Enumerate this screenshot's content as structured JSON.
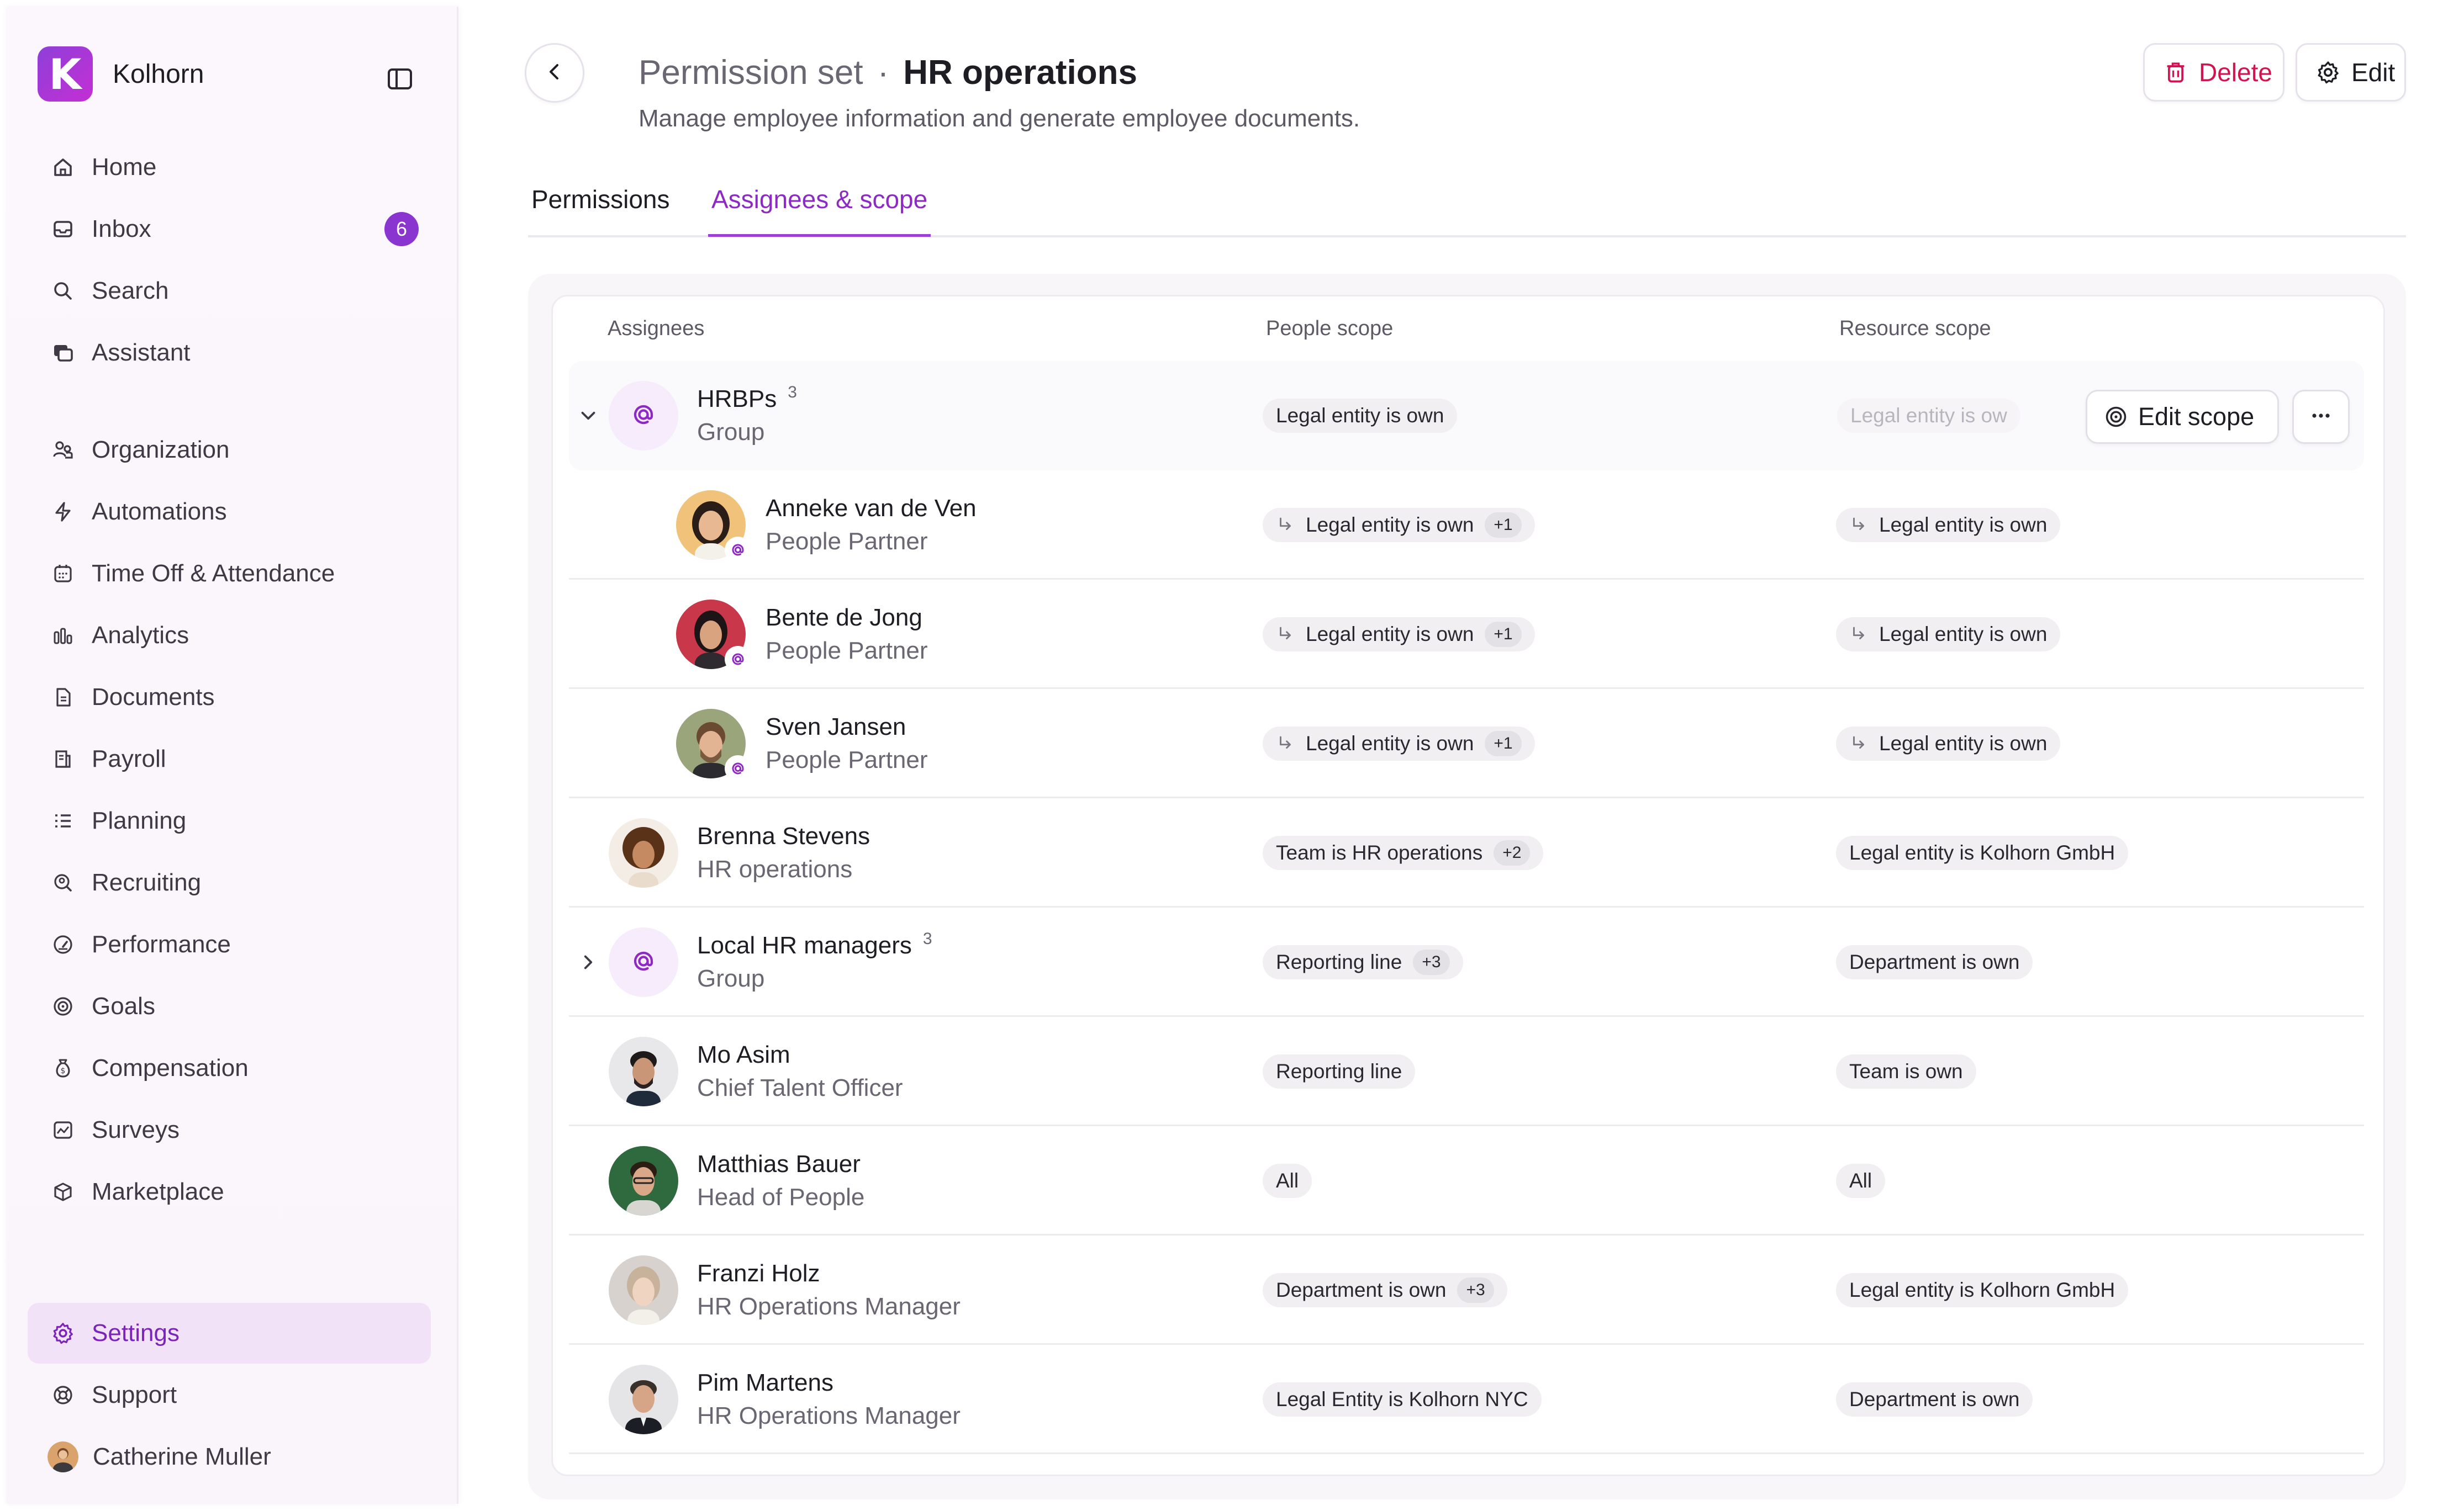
{
  "brand": {
    "name": "Kolhorn",
    "logo_letter": "K"
  },
  "sidebar": {
    "items": [
      {
        "label": "Home",
        "icon": "home-icon"
      },
      {
        "label": "Inbox",
        "icon": "inbox-icon",
        "badge": "6"
      },
      {
        "label": "Search",
        "icon": "search-icon"
      },
      {
        "label": "Assistant",
        "icon": "assistant-icon"
      },
      {
        "label": "Organization",
        "icon": "organization-icon"
      },
      {
        "label": "Automations",
        "icon": "bolt-icon"
      },
      {
        "label": "Time Off & Attendance",
        "icon": "calendar-icon"
      },
      {
        "label": "Analytics",
        "icon": "bar-chart-icon"
      },
      {
        "label": "Documents",
        "icon": "document-icon"
      },
      {
        "label": "Payroll",
        "icon": "payroll-icon"
      },
      {
        "label": "Planning",
        "icon": "list-icon"
      },
      {
        "label": "Recruiting",
        "icon": "recruiting-icon"
      },
      {
        "label": "Performance",
        "icon": "gauge-icon"
      },
      {
        "label": "Goals",
        "icon": "target-icon"
      },
      {
        "label": "Compensation",
        "icon": "money-bag-icon"
      },
      {
        "label": "Surveys",
        "icon": "survey-icon"
      },
      {
        "label": "Marketplace",
        "icon": "package-icon"
      }
    ],
    "bottom": [
      {
        "label": "Settings",
        "icon": "gear-icon",
        "active": true
      },
      {
        "label": "Support",
        "icon": "lifebuoy-icon"
      },
      {
        "label": "Catherine Muller",
        "icon": "user-avatar"
      }
    ]
  },
  "header": {
    "title_prefix": "Permission set",
    "title_separator": "·",
    "title": "HR operations",
    "subtitle": "Manage employee information and generate employee documents.",
    "delete_label": "Delete",
    "edit_label": "Edit"
  },
  "tabs": [
    {
      "label": "Permissions",
      "active": false
    },
    {
      "label": "Assignees & scope",
      "active": true
    }
  ],
  "table": {
    "columns": [
      "Assignees",
      "People scope",
      "Resource scope"
    ],
    "edit_scope_label": "Edit scope",
    "rows": [
      {
        "type": "group",
        "expanded": true,
        "name": "HRBPs",
        "count": "3",
        "sub": "Group",
        "people": "Legal entity is own",
        "resource": "Legal entity is ow"
      },
      {
        "type": "member",
        "name": "Anneke van de Ven",
        "sub": "People Partner",
        "people": "Legal entity is own",
        "people_extra": "+1",
        "resource": "Legal entity is own"
      },
      {
        "type": "member",
        "name": "Bente de Jong",
        "sub": "People Partner",
        "people": "Legal entity is own",
        "people_extra": "+1",
        "resource": "Legal entity is own"
      },
      {
        "type": "member",
        "name": "Sven Jansen",
        "sub": "People Partner",
        "people": "Legal entity is own",
        "people_extra": "+1",
        "resource": "Legal entity is own"
      },
      {
        "type": "person",
        "name": "Brenna Stevens",
        "sub": "HR operations",
        "people": "Team is HR operations",
        "people_extra": "+2",
        "resource": "Legal entity is Kolhorn GmbH"
      },
      {
        "type": "group",
        "expanded": false,
        "name": "Local HR managers",
        "count": "3",
        "sub": "Group",
        "people": "Reporting line",
        "people_extra": "+3",
        "resource": "Department is own"
      },
      {
        "type": "person",
        "name": "Mo Asim",
        "sub": "Chief Talent Officer",
        "people": "Reporting line",
        "resource": "Team is own"
      },
      {
        "type": "person",
        "name": "Matthias Bauer",
        "sub": "Head of People",
        "people": "All",
        "resource": "All"
      },
      {
        "type": "person",
        "name": "Franzi Holz",
        "sub": "HR Operations Manager",
        "people": "Department is own",
        "people_extra": "+3",
        "resource": "Legal entity is Kolhorn GmbH"
      },
      {
        "type": "person",
        "name": "Pim Martens",
        "sub": "HR Operations Manager",
        "people": "Legal Entity is Kolhorn NYC",
        "resource": "Department is own"
      }
    ]
  },
  "colors": {
    "accent": "#8e2ac4",
    "badge": "#8b35d1",
    "delete": "#d1144f",
    "active_nav_bg": "#f2e2f7"
  }
}
